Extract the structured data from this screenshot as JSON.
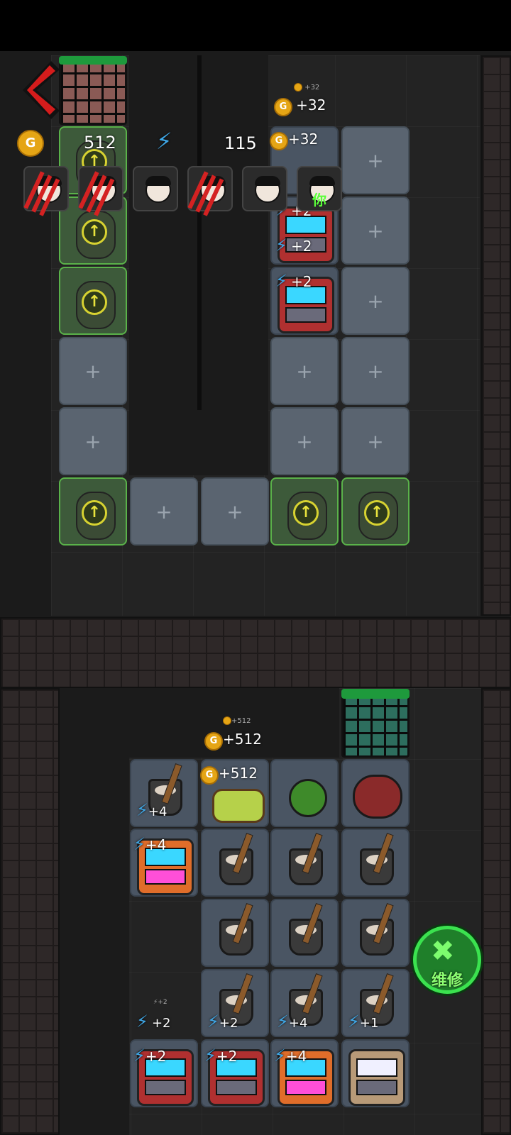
{
  "hud": {
    "coins": "512",
    "energy": "115",
    "coin_icon": "G"
  },
  "avatars": [
    {
      "name": "scratched-avatar-1"
    },
    {
      "name": "scratched-avatar-2"
    },
    {
      "name": "girl-avatar"
    },
    {
      "name": "scratched-avatar-4"
    },
    {
      "name": "boy-avatar"
    },
    {
      "name": "girl-you-avatar",
      "label": "你"
    }
  ],
  "room_top": {
    "small_coin_gain": "+32",
    "coin_gain": "+32",
    "coin_gain_float": "+32",
    "energy_gains": [
      "+2",
      "+2",
      "+2",
      "+2"
    ]
  },
  "room_bottom": {
    "small_coin_gain": "+512",
    "coin_gain": "+512",
    "coin_gain_float": "+512",
    "row1_energy": "+4",
    "row2_energy": "+4",
    "small_energy": "+2",
    "row5_energy": [
      "+2",
      "+2",
      "+4",
      "+1"
    ],
    "row6_energy": [
      "+2",
      "+2",
      "+4"
    ]
  },
  "repair_button": {
    "label": "维修"
  },
  "colors": {
    "accent_green": "#3be24f",
    "coin_gold": "#e5a515",
    "energy_blue": "#3fa7e6",
    "danger_red": "#d42222"
  }
}
